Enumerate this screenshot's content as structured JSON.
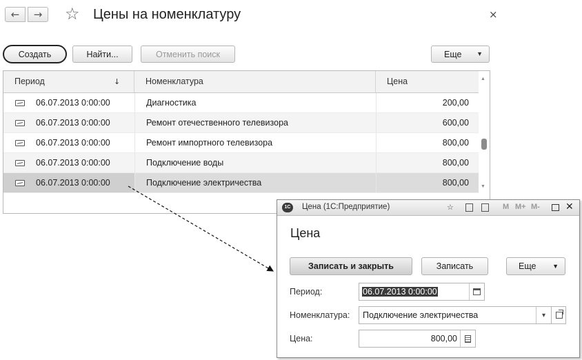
{
  "main": {
    "title": "Цены на номенклатуру",
    "nav": {
      "back_icon": "←",
      "forward_icon": "→"
    },
    "star_icon": "☆",
    "close_icon": "×",
    "toolbar": {
      "create_label": "Создать",
      "find_label": "Найти...",
      "cancel_search_label": "Отменить поиск",
      "more_label": "Еще",
      "more_arrow": "▼"
    },
    "table": {
      "columns": [
        "Период",
        "Номенклатура",
        "Цена"
      ],
      "sort_icon": "↓",
      "rows": [
        {
          "period": "06.07.2013 0:00:00",
          "item": "Диагностика",
          "price": "200,00"
        },
        {
          "period": "06.07.2013 0:00:00",
          "item": "Ремонт отечественного телевизора",
          "price": "600,00"
        },
        {
          "period": "06.07.2013 0:00:00",
          "item": "Ремонт импортного телевизора",
          "price": "800,00"
        },
        {
          "period": "06.07.2013 0:00:00",
          "item": "Подключение воды",
          "price": "800,00"
        },
        {
          "period": "06.07.2013 0:00:00",
          "item": "Подключение электричества",
          "price": "800,00"
        }
      ],
      "selected_row": 4
    }
  },
  "dialog": {
    "window_title": "Цена (1С:Предприятие)",
    "logo_text": "1С",
    "titlebar": {
      "m": "M",
      "m_plus": "M+",
      "m_minus": "M-",
      "close": "✕"
    },
    "heading": "Цена",
    "buttons": {
      "save_close": "Записать и закрыть",
      "save": "Записать",
      "more": "Еще",
      "more_arrow": "▼"
    },
    "fields": {
      "period_label": "Период:",
      "period_value": "06.07.2013  0:00:00",
      "item_label": "Номенклатура:",
      "item_value": "Подключение электричества",
      "item_dropdown": "▾",
      "price_label": "Цена:",
      "price_value": "800,00"
    }
  }
}
